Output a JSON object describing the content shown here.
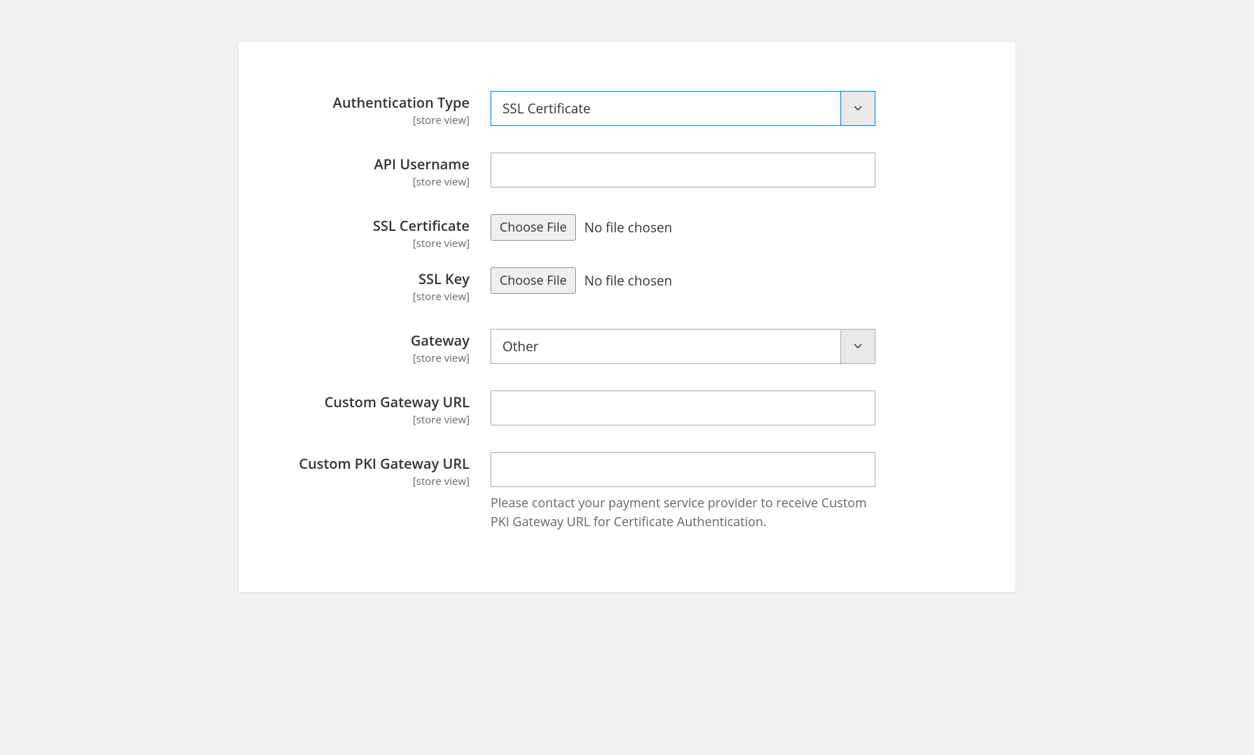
{
  "scope_text": "[store view]",
  "fields": {
    "auth_type": {
      "label": "Authentication Type",
      "value": "SSL Certificate"
    },
    "api_username": {
      "label": "API Username",
      "value": ""
    },
    "ssl_cert": {
      "label": "SSL Certificate",
      "button": "Choose File",
      "status": "No file chosen"
    },
    "ssl_key": {
      "label": "SSL Key",
      "button": "Choose File",
      "status": "No file chosen"
    },
    "gateway": {
      "label": "Gateway",
      "value": "Other"
    },
    "custom_gateway_url": {
      "label": "Custom Gateway URL",
      "value": ""
    },
    "custom_pki_url": {
      "label": "Custom PKI Gateway URL",
      "value": "",
      "help": "Please contact your payment service provider to receive Custom PKI Gateway URL for Certificate Authentication."
    }
  }
}
